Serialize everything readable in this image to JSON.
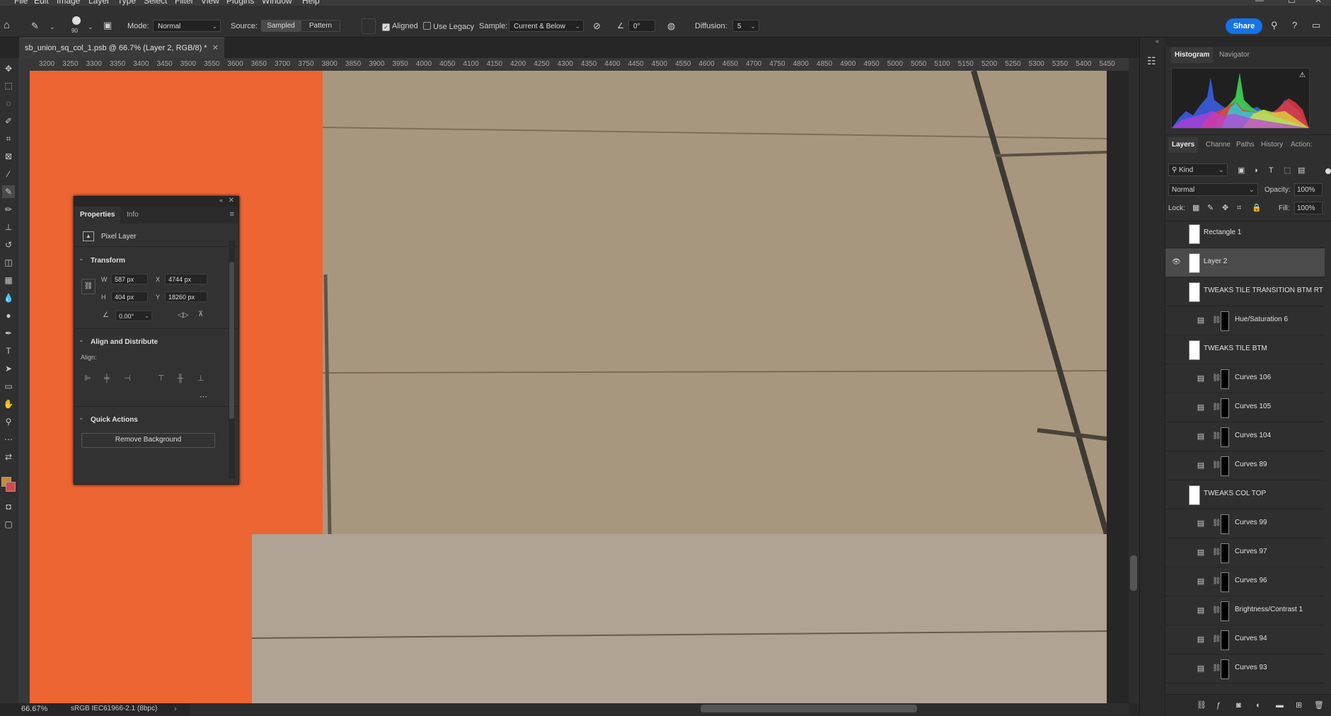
{
  "menubar": {
    "items": [
      "File",
      "Edit",
      "Image",
      "Layer",
      "Type",
      "Select",
      "Filter",
      "View",
      "Plugins",
      "Window",
      "Help"
    ]
  },
  "options": {
    "brush_size": "90",
    "mode_label": "Mode:",
    "mode_value": "Normal",
    "source_label": "Source:",
    "source_sampled": "Sampled",
    "source_pattern": "Pattern",
    "aligned_label": "Aligned",
    "use_legacy_label": "Use Legacy",
    "sample_label": "Sample:",
    "sample_value": "Current & Below",
    "angle_value": "0°",
    "diffusion_label": "Diffusion:",
    "diffusion_value": "5",
    "share_label": "Share"
  },
  "document": {
    "tab_title": "sb_union_sq_col_1.psb @ 66.7% (Layer 2, RGB/8) *"
  },
  "ruler": {
    "ticks": [
      "3200",
      "3250",
      "3300",
      "3350",
      "3400",
      "3450",
      "3500",
      "3550",
      "3600",
      "3650",
      "3700",
      "3750",
      "3800",
      "3850",
      "3900",
      "3950",
      "4000",
      "4050",
      "4100",
      "4150",
      "4200",
      "4250",
      "4300",
      "4350",
      "4400",
      "4450",
      "4500",
      "4550",
      "4600",
      "4650",
      "4700",
      "4750",
      "4800",
      "4850",
      "4900",
      "4950",
      "5000",
      "5050",
      "5100",
      "5150",
      "5200",
      "5250",
      "5300",
      "5350",
      "5400",
      "5450"
    ]
  },
  "status": {
    "zoom": "66.67%",
    "profile": "sRGB IEC61966-2.1 (8bpc)"
  },
  "properties": {
    "tab_properties": "Properties",
    "tab_info": "Info",
    "layer_type": "Pixel Layer",
    "transform_title": "Transform",
    "w_label": "W",
    "w_value": "587 px",
    "x_label": "X",
    "x_value": "4744 px",
    "h_label": "H",
    "h_value": "404 px",
    "y_label": "Y",
    "y_value": "18260 px",
    "angle_value": "0.00°",
    "align_title": "Align and Distribute",
    "align_label": "Align:",
    "quick_title": "Quick Actions",
    "remove_bg": "Remove Background"
  },
  "dock": {
    "tab_histogram": "Histogram",
    "tab_navigator": "Navigator",
    "tabs": [
      "Layers",
      "Channe",
      "Paths",
      "History",
      "Action:"
    ],
    "kind_label": "Kind",
    "blend_mode": "Normal",
    "opacity_label": "Opacity:",
    "opacity_value": "100%",
    "lock_label": "Lock:",
    "fill_label": "Fill:",
    "fill_value": "100%"
  },
  "layers": [
    {
      "name": "Rectangle 1",
      "type": "pixel",
      "visible": false,
      "selected": false
    },
    {
      "name": "Layer 2",
      "type": "pixel",
      "visible": true,
      "selected": true
    },
    {
      "name": "TWEAKS TILE TRANSITION BTM RT",
      "type": "pixel",
      "visible": false,
      "selected": false
    },
    {
      "name": "Hue/Saturation 6",
      "type": "adjustment",
      "visible": false,
      "selected": false
    },
    {
      "name": "TWEAKS TILE BTM",
      "type": "pixel",
      "visible": false,
      "selected": false
    },
    {
      "name": "Curves 106",
      "type": "adjustment",
      "visible": false,
      "selected": false
    },
    {
      "name": "Curves 105",
      "type": "adjustment",
      "visible": false,
      "selected": false
    },
    {
      "name": "Curves 104",
      "type": "adjustment",
      "visible": false,
      "selected": false
    },
    {
      "name": "Curves 89",
      "type": "adjustment",
      "visible": false,
      "selected": false
    },
    {
      "name": "TWEAKS COL TOP",
      "type": "pixel",
      "visible": false,
      "selected": false
    },
    {
      "name": "Curves 99",
      "type": "adjustment",
      "visible": false,
      "selected": false
    },
    {
      "name": "Curves 97",
      "type": "adjustment",
      "visible": false,
      "selected": false
    },
    {
      "name": "Curves 96",
      "type": "adjustment",
      "visible": false,
      "selected": false
    },
    {
      "name": "Brightness/Contrast 1",
      "type": "adjustment",
      "visible": false,
      "selected": false
    },
    {
      "name": "Curves 94",
      "type": "adjustment",
      "visible": false,
      "selected": false
    },
    {
      "name": "Curves 93",
      "type": "adjustment",
      "visible": false,
      "selected": false
    }
  ],
  "colors": {
    "accent": "#1473e6",
    "canvas_orange": "#ec6533",
    "tile": "#a8977f"
  }
}
